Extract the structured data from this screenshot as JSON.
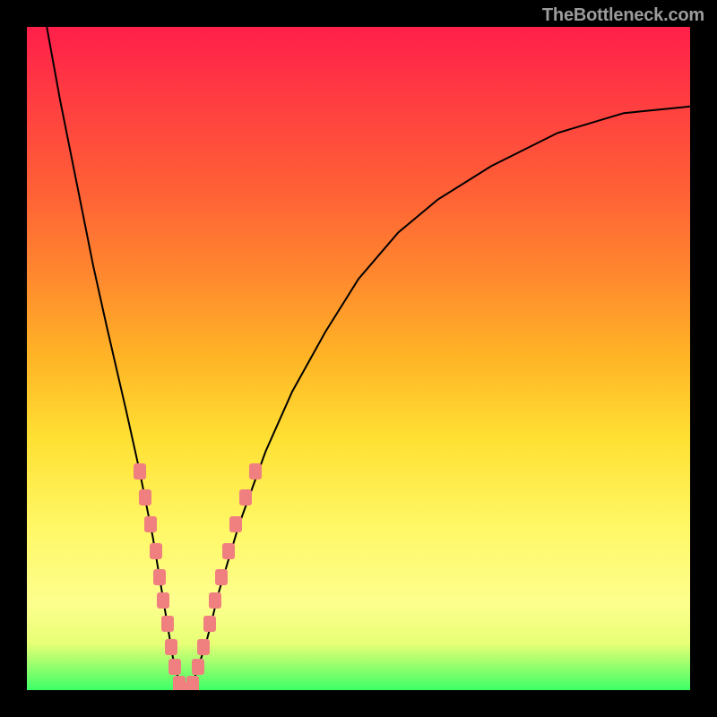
{
  "watermark": "TheBottleneck.com",
  "colors": {
    "frame_bg": "#000000",
    "gradient_top": "#ff1f4a",
    "gradient_bottom": "#3cff66",
    "curve": "#000000",
    "dots": "#f08080",
    "watermark": "#9c9c9c"
  },
  "chart_data": {
    "type": "line",
    "title": "",
    "xlabel": "",
    "ylabel": "",
    "xlim": [
      0,
      100
    ],
    "ylim": [
      0,
      100
    ],
    "grid": false,
    "legend": false,
    "series": [
      {
        "name": "curve",
        "x": [
          3,
          5,
          8,
          10,
          12,
          15,
          17,
          19,
          20,
          21,
          22,
          23,
          24,
          25,
          27,
          29,
          32,
          36,
          40,
          45,
          50,
          56,
          62,
          70,
          80,
          90,
          100
        ],
        "y": [
          100,
          89,
          74,
          64,
          55,
          42,
          33,
          23,
          17,
          11,
          5,
          1,
          0,
          1,
          7,
          15,
          25,
          36,
          45,
          54,
          62,
          69,
          74,
          79,
          84,
          87,
          88
        ]
      }
    ],
    "points": [
      {
        "x": 17.0,
        "y": 33.0
      },
      {
        "x": 17.8,
        "y": 29.0
      },
      {
        "x": 18.7,
        "y": 25.0
      },
      {
        "x": 19.4,
        "y": 21.0
      },
      {
        "x": 20.0,
        "y": 17.0
      },
      {
        "x": 20.6,
        "y": 13.5
      },
      {
        "x": 21.2,
        "y": 10.0
      },
      {
        "x": 21.7,
        "y": 6.5
      },
      {
        "x": 22.3,
        "y": 3.5
      },
      {
        "x": 23.0,
        "y": 1.0
      },
      {
        "x": 24.0,
        "y": 0.0
      },
      {
        "x": 25.0,
        "y": 1.0
      },
      {
        "x": 25.8,
        "y": 3.5
      },
      {
        "x": 26.6,
        "y": 6.5
      },
      {
        "x": 27.5,
        "y": 10.0
      },
      {
        "x": 28.4,
        "y": 13.5
      },
      {
        "x": 29.3,
        "y": 17.0
      },
      {
        "x": 30.4,
        "y": 21.0
      },
      {
        "x": 31.5,
        "y": 25.0
      },
      {
        "x": 33.0,
        "y": 29.0
      },
      {
        "x": 34.5,
        "y": 33.0
      }
    ]
  }
}
